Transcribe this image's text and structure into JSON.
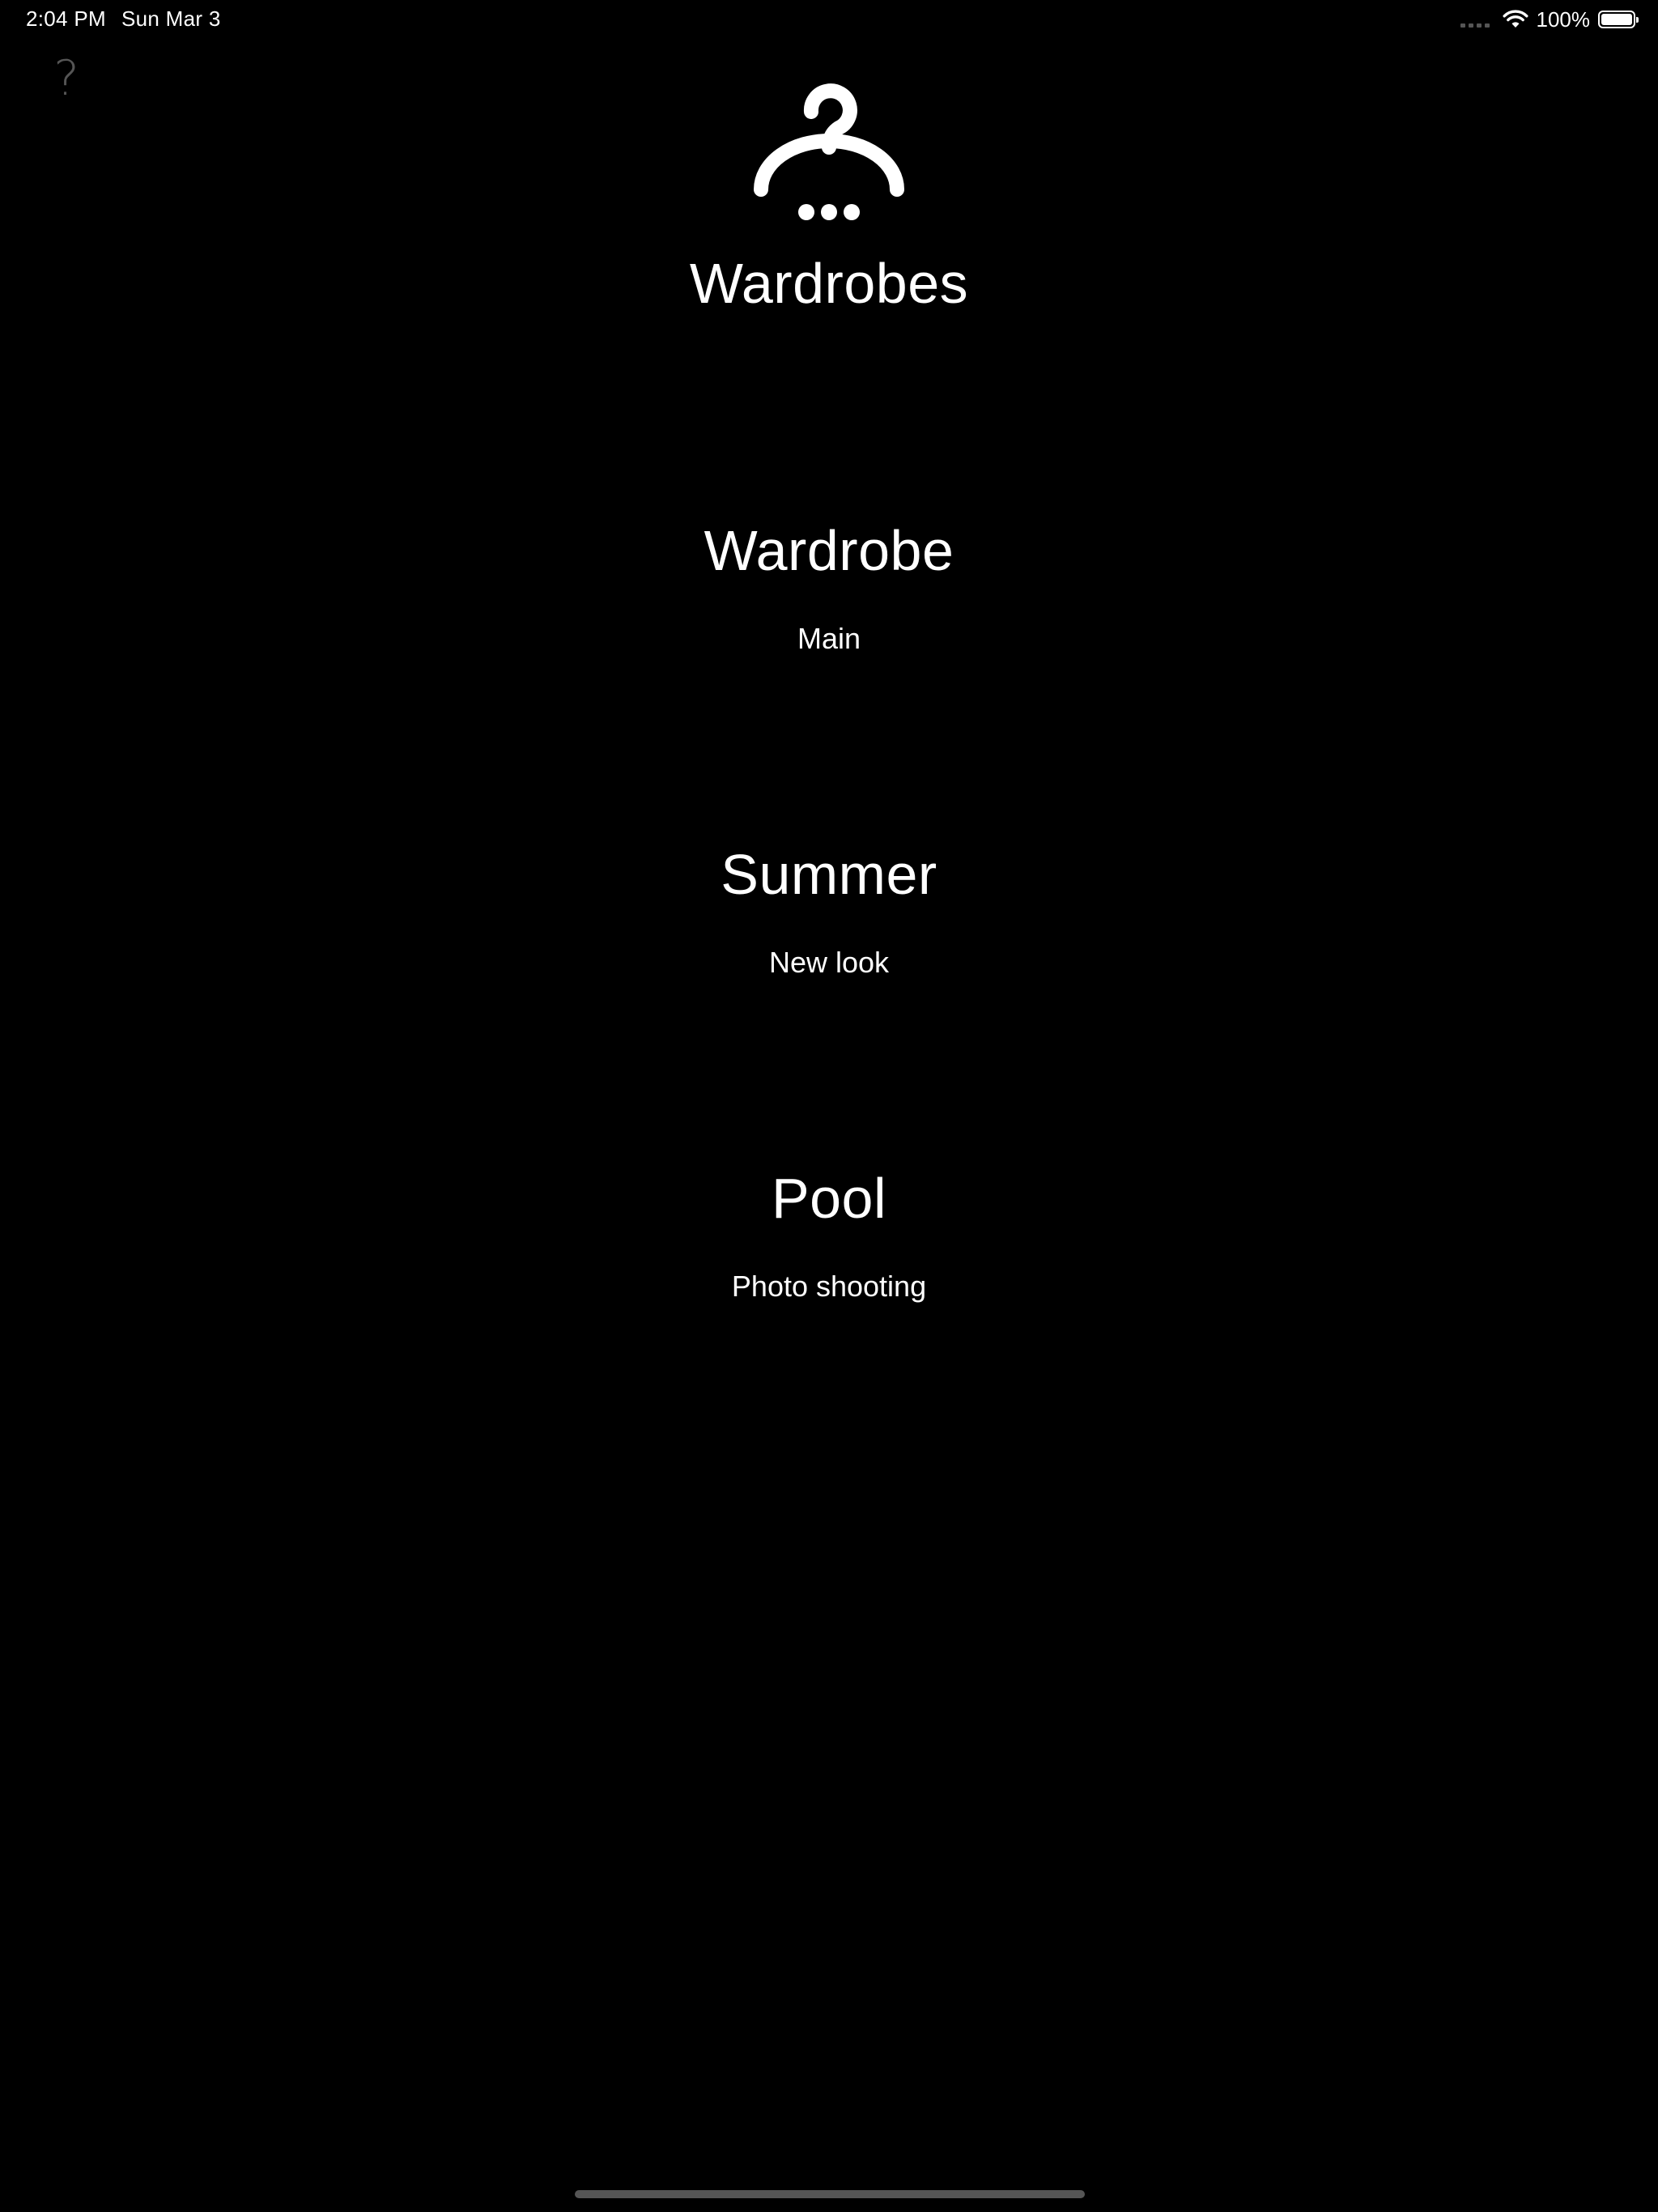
{
  "status_bar": {
    "time": "2:04 PM",
    "date": "Sun Mar 3",
    "battery_percent": "100%",
    "icons": [
      "cellular-signal-icon",
      "wifi-icon",
      "battery-icon"
    ]
  },
  "help_button": {
    "label": "?",
    "icon": "question-mark-icon"
  },
  "header": {
    "logo_icon": "hanger-question-icon",
    "title": "Wardrobes"
  },
  "wardrobes": [
    {
      "title": "Wardrobe",
      "subtitle": "Main"
    },
    {
      "title": "Summer",
      "subtitle": "New look"
    },
    {
      "title": "Pool",
      "subtitle": "Photo shooting"
    }
  ],
  "colors": {
    "background": "#000000",
    "text": "#ffffff",
    "muted": "#555555"
  }
}
